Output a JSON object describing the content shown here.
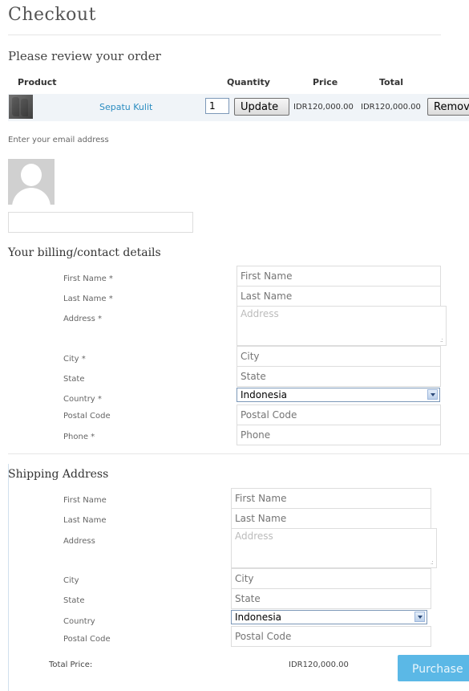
{
  "page": {
    "title": "Checkout",
    "review_heading": "Please review your order"
  },
  "cart": {
    "columns": {
      "product": "Product",
      "quantity": "Quantity",
      "price": "Price",
      "total": "Total"
    },
    "item": {
      "name": "Sepatu Kulit",
      "quantity": "1",
      "price": "IDR120,000.00",
      "total": "IDR120,000.00",
      "update_label": "Update",
      "remove_label": "Remove"
    }
  },
  "email": {
    "label": "Enter your email address",
    "value": ""
  },
  "billing": {
    "heading": "Your billing/contact details",
    "labels": {
      "first_name": "First Name *",
      "last_name": "Last Name *",
      "address": "Address *",
      "city": "City *",
      "state": "State",
      "country": "Country *",
      "postal_code": "Postal Code",
      "phone": "Phone *"
    },
    "placeholders": {
      "first_name": "First Name",
      "last_name": "Last Name",
      "address": "Address",
      "city": "City",
      "state": "State",
      "postal_code": "Postal Code",
      "phone": "Phone"
    },
    "country_value": "Indonesia"
  },
  "shipping": {
    "heading": "Shipping Address",
    "labels": {
      "first_name": "First Name",
      "last_name": "Last Name",
      "address": "Address",
      "city": "City",
      "state": "State",
      "country": "Country",
      "postal_code": "Postal Code"
    },
    "placeholders": {
      "first_name": "First Name",
      "last_name": "Last Name",
      "address": "Address",
      "city": "City",
      "state": "State",
      "postal_code": "Postal Code"
    },
    "country_value": "Indonesia"
  },
  "summary": {
    "total_label": "Total Price:",
    "total_value": "IDR120,000.00",
    "purchase_label": "Purchase"
  },
  "colors": {
    "link": "#2a8cc0",
    "purchase_button": "#5bb8e6",
    "cart_row_bg": "#f0f4f8"
  }
}
